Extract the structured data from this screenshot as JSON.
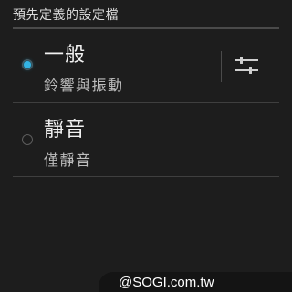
{
  "section": {
    "header": "預先定義的設定檔"
  },
  "profiles": [
    {
      "title": "一般",
      "subtitle": "鈴響與振動",
      "selected": true,
      "has_settings": true
    },
    {
      "title": "靜音",
      "subtitle": "僅靜音",
      "selected": false,
      "has_settings": false
    }
  ],
  "icons": {
    "settings": "sliders-icon"
  },
  "colors": {
    "accent": "#33b5e5",
    "background": "#1d1d1d"
  },
  "watermark": {
    "text": "@SOGI.com.tw"
  }
}
